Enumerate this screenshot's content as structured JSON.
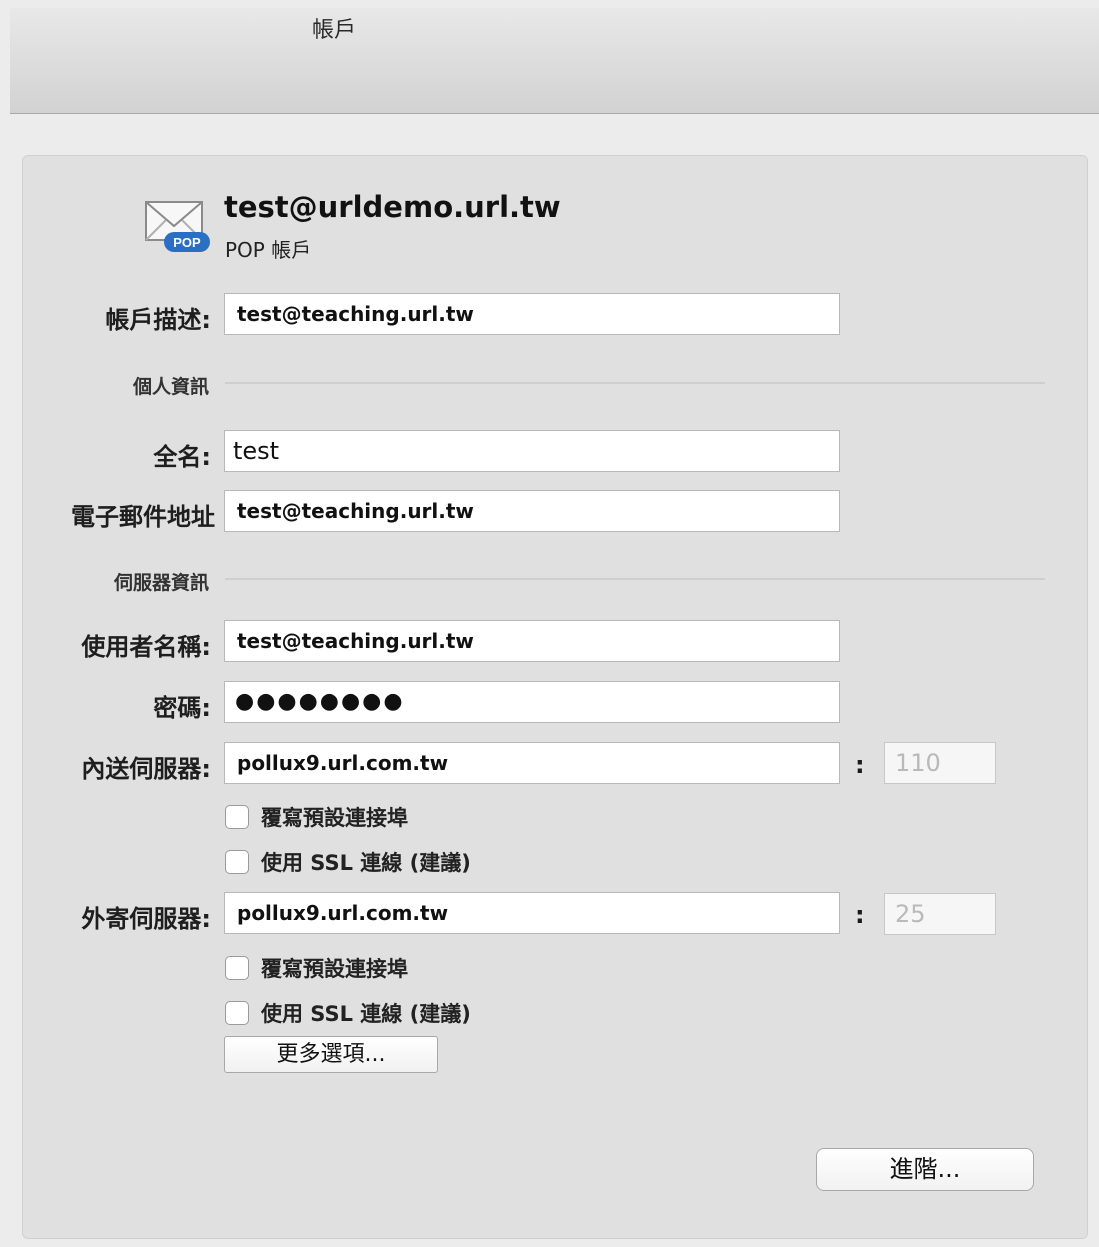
{
  "window": {
    "title": "帳戶"
  },
  "account": {
    "email": "test@urldemo.url.tw",
    "type": "POP 帳戶",
    "icon_badge": "POP",
    "icon": "mail-envelope-icon"
  },
  "fields": {
    "description": {
      "label": "帳戶描述:",
      "value": "test@teaching.url.tw"
    },
    "personal_section": "個人資訊",
    "full_name": {
      "label": "全名:",
      "value": "test"
    },
    "email": {
      "label": "電子郵件地址",
      "value": "test@teaching.url.tw"
    },
    "server_section": "伺服器資訊",
    "username": {
      "label": "使用者名稱:",
      "value": "test@teaching.url.tw"
    },
    "password": {
      "label": "密碼:",
      "value": "●●●●●●●●"
    },
    "incoming": {
      "label": "內送伺服器:",
      "value": "pollux9.url.com.tw",
      "colon": ":",
      "port": "110",
      "override_port": {
        "label": "覆寫預設連接埠",
        "checked": false
      },
      "use_ssl": {
        "label": "使用 SSL 連線 (建議)",
        "checked": false
      }
    },
    "outgoing": {
      "label": "外寄伺服器:",
      "value": "pollux9.url.com.tw",
      "colon": ":",
      "port": "25",
      "override_port": {
        "label": "覆寫預設連接埠",
        "checked": false
      },
      "use_ssl": {
        "label": "使用 SSL 連線 (建議)",
        "checked": false
      }
    }
  },
  "buttons": {
    "more_options": "更多選項...",
    "advanced": "進階..."
  }
}
